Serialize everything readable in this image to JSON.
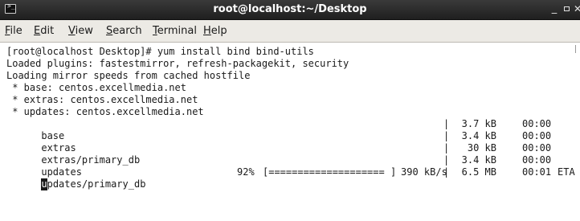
{
  "window": {
    "title": "root@localhost:~/Desktop",
    "icon": "terminal-icon",
    "controls": {
      "minimize": "_",
      "maximize": "maximize-icon",
      "close": "✕"
    }
  },
  "menubar": {
    "items": [
      {
        "mnemonic": "F",
        "rest": "ile"
      },
      {
        "mnemonic": "E",
        "rest": "dit"
      },
      {
        "mnemonic": "V",
        "rest": "iew"
      },
      {
        "mnemonic": "S",
        "rest": "earch"
      },
      {
        "mnemonic": "T",
        "rest": "erminal"
      },
      {
        "mnemonic": "H",
        "rest": "elp"
      }
    ]
  },
  "terminal": {
    "lines": [
      "[root@localhost Desktop]# yum install bind bind-utils",
      "Loaded plugins: fastestmirror, refresh-packagekit, security",
      "Loading mirror speeds from cached hostfile",
      " * base: centos.excellmedia.net",
      " * extras: centos.excellmedia.net",
      " * updates: centos.excellmedia.net"
    ],
    "downloads": [
      {
        "name": "base",
        "sep": "|",
        "size": "3.7 kB",
        "time": "00:00"
      },
      {
        "name": "extras",
        "sep": "|",
        "size": "3.4 kB",
        "time": "00:00"
      },
      {
        "name": "extras/primary_db",
        "sep": "|",
        "size": "30 kB",
        "time": "00:00"
      },
      {
        "name": "updates",
        "sep": "|",
        "size": "3.4 kB",
        "time": "00:00"
      }
    ],
    "progress": {
      "cursor_char": "u",
      "name_rest": "pdates/primary_db",
      "percent": "92%",
      "bar": "[==================== ]",
      "rate": "390 kB/s",
      "sep": "|",
      "size": "6.5 MB",
      "time": "00:01",
      "eta_label": "ETA"
    }
  },
  "colors": {
    "titlebar": "#2b2b2b",
    "menubar": "#eceae5",
    "terminal_bg": "#ffffff",
    "terminal_fg": "#1a1a1a"
  }
}
